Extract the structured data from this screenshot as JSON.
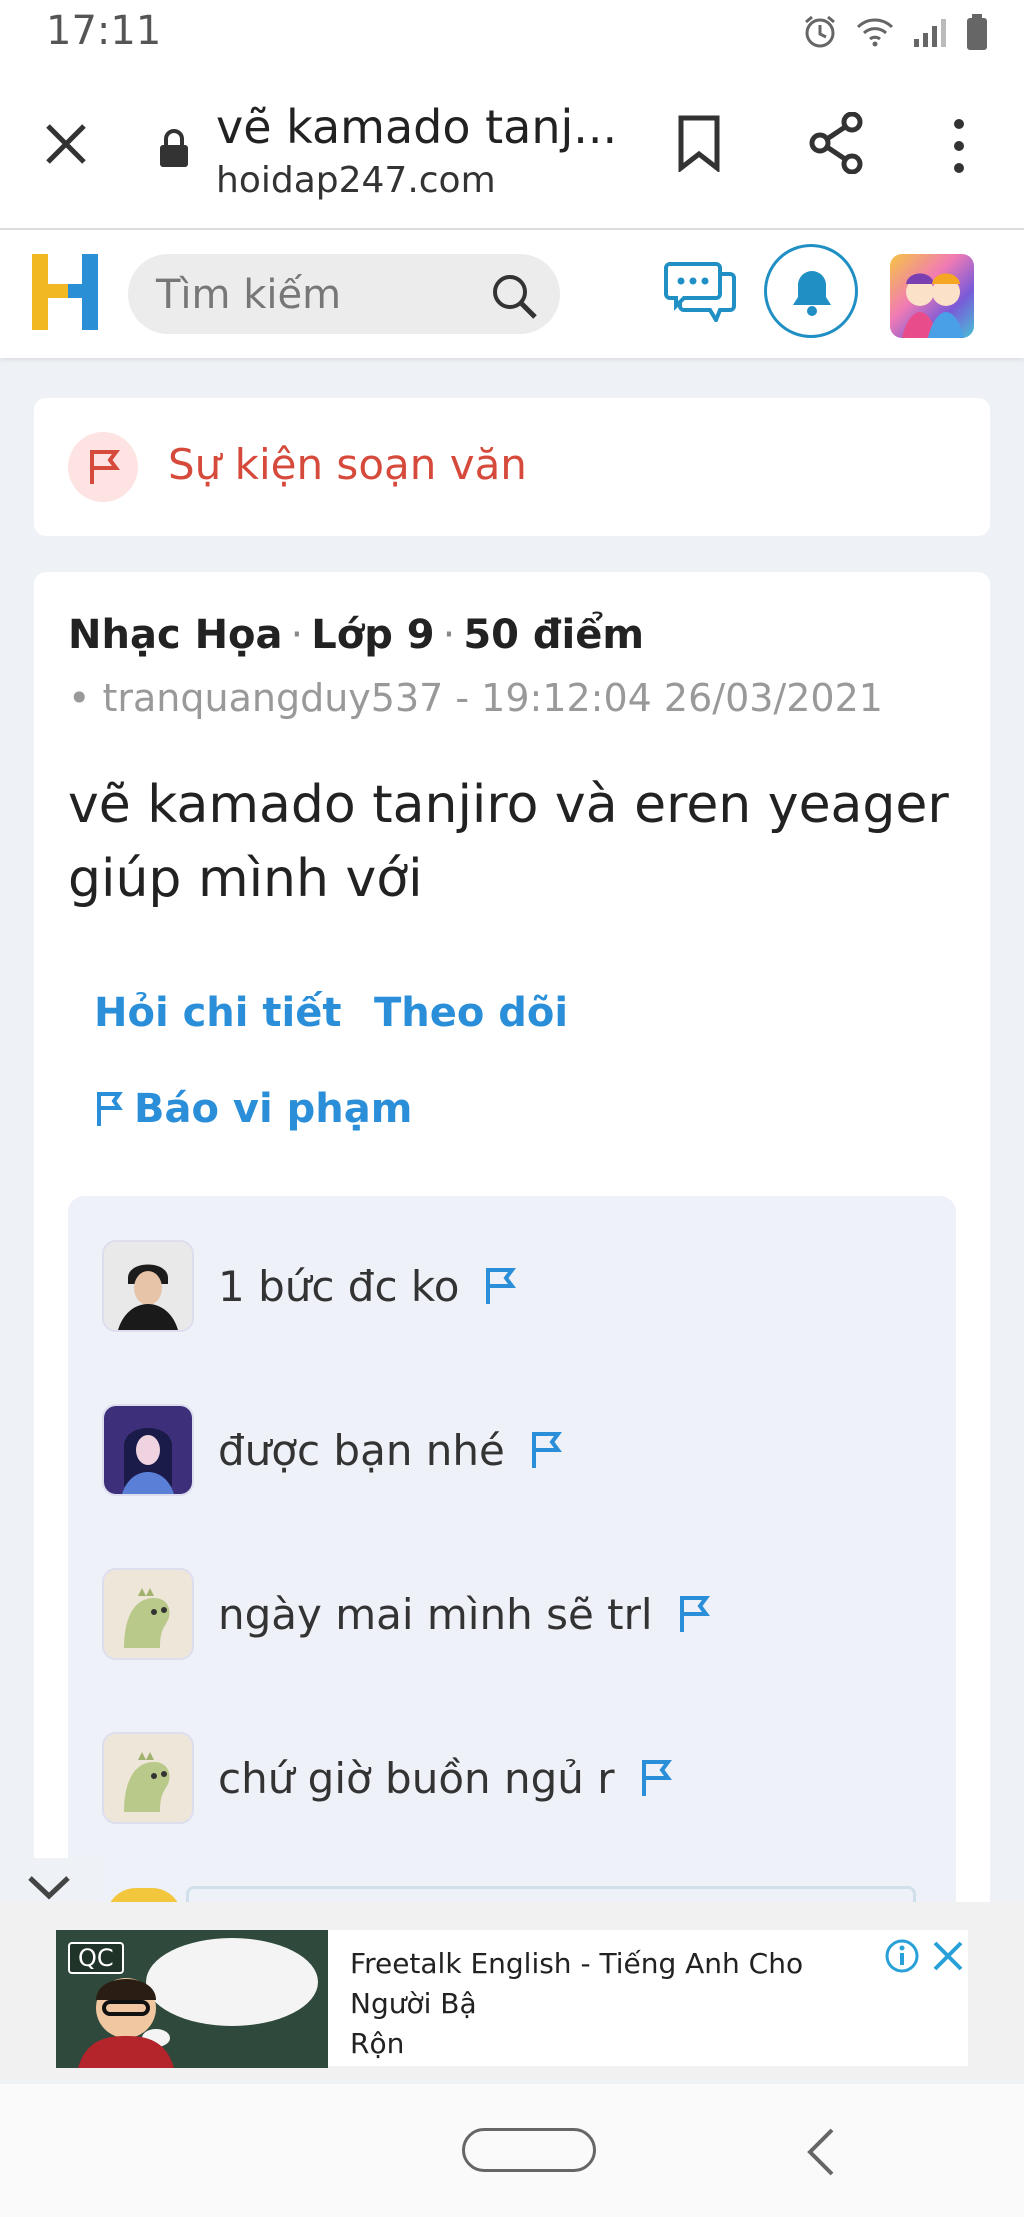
{
  "status_bar": {
    "time": "17:11"
  },
  "browser": {
    "page_title": "vẽ kamado tanj...",
    "domain": "hoidap247.com"
  },
  "site_header": {
    "logo_letter": "H",
    "search_placeholder": "Tìm kiếm"
  },
  "event": {
    "label": "Sự kiện soạn văn"
  },
  "question": {
    "subject": "Nhạc Họa",
    "grade": "Lớp 9",
    "points": "50 điểm",
    "separator": "·",
    "byline": "• tranquangduy537 - 19:12:04 26/03/2021",
    "text": "vẽ kamado tanjiro và eren yeager giúp mình với",
    "actions": {
      "ask_detail": "Hỏi chi tiết",
      "follow": "Theo dõi",
      "report": "Báo vi phạm"
    }
  },
  "comments": [
    {
      "text": "1 bức đc ko",
      "avatar": "boy-photo"
    },
    {
      "text": "được bạn nhé",
      "avatar": "anime-girl"
    },
    {
      "text": "ngày mai mình sẽ trl",
      "avatar": "dino-sticker"
    },
    {
      "text": "chứ giờ buồn ngủ r",
      "avatar": "dino-sticker"
    }
  ],
  "ad": {
    "tag": "QC",
    "text": "Freetalk English - Tiếng Anh Cho Người Bận Rộn",
    "text_line1": "Freetalk English - Tiếng Anh Cho Người Bậ",
    "text_line2": "Rộn"
  },
  "colors": {
    "brand_blue": "#2a8fd8",
    "event_red": "#d64a3c",
    "logo_yellow": "#f2b823",
    "logo_blue": "#2b8fd6"
  }
}
